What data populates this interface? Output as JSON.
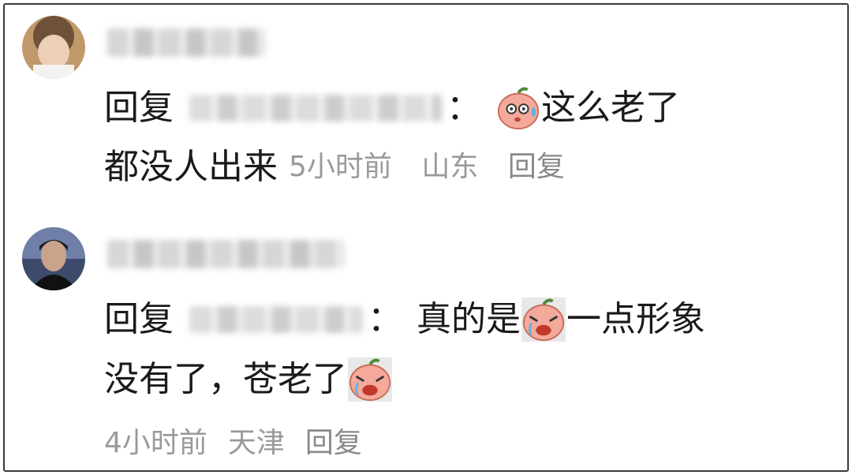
{
  "comments": [
    {
      "reply_prefix": "回复",
      "colon": "：",
      "text_part1": "这么老了",
      "text_part2": "都没人出来",
      "emoji_icon": "sweating-peach-emoji",
      "time": "5小时前",
      "location": "山东",
      "reply_action": "回复"
    },
    {
      "reply_prefix": "回复",
      "colon": "：",
      "text_part1": "真的是",
      "text_part2": "一点形象",
      "text_part3": "没有了，苍老了",
      "emoji_icon": "crying-peach-emoji",
      "time": "4小时前",
      "location": "天津",
      "reply_action": "回复"
    }
  ],
  "colors": {
    "meta_text": "#9a9a9a",
    "body_text": "#1a1a1a",
    "emoji_pink": "#f5a99b"
  }
}
